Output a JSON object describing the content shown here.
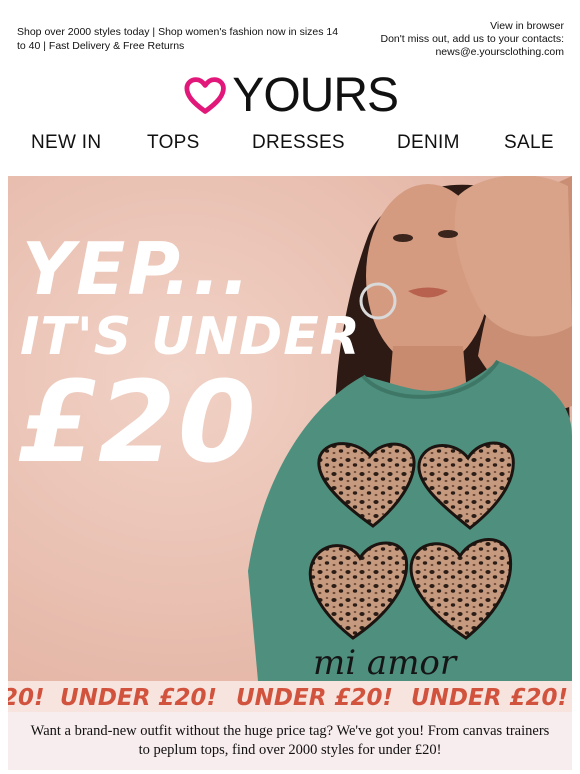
{
  "preheader": {
    "left_text": "Shop over 2000 styles today | Shop women's fashion now in sizes 14 to 40 | Fast Delivery & Free Returns",
    "view_in_browser": "View in browser",
    "contacts_note": "Don't miss out, add us to your contacts:",
    "email": "news@e.yoursclothing.com"
  },
  "brand": {
    "name": "YOURS",
    "heart_color": "#e2177a"
  },
  "nav": {
    "items": [
      {
        "label": "NEW IN"
      },
      {
        "label": "TOPS"
      },
      {
        "label": "DRESSES"
      },
      {
        "label": "DENIM"
      },
      {
        "label": "SALE"
      }
    ]
  },
  "hero": {
    "headline_line1": "YEP...",
    "headline_line2": "IT'S UNDER",
    "headline_line3": "£20",
    "shirt_print_text": "mi amor",
    "background_color": "#e9c3b4",
    "shirt_color": "#4e8f7e"
  },
  "ticker": {
    "label": "UNDER £20!",
    "fragment": "20!",
    "color": "#d2533d"
  },
  "intro": {
    "text": "Want a brand-new outfit without the huge price tag? We've got you! From canvas trainers to peplum tops, find over 2000 styles for under £20!"
  }
}
